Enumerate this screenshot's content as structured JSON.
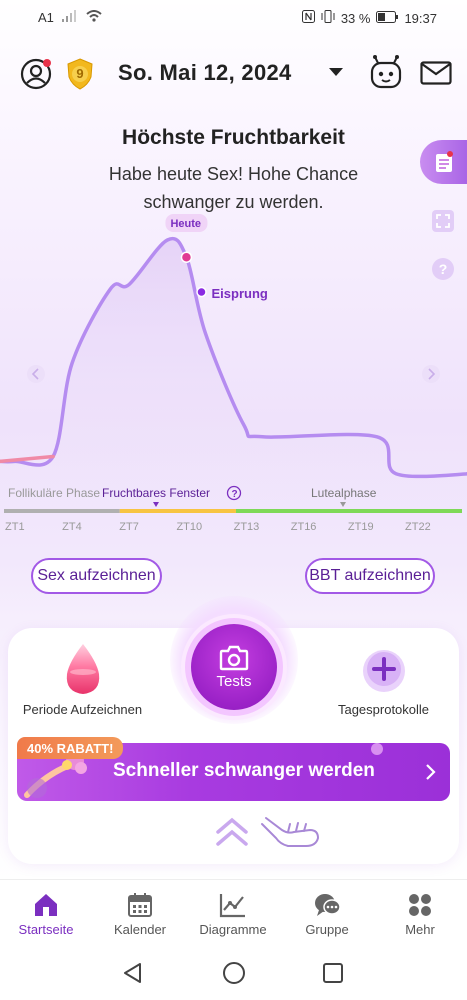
{
  "status_bar": {
    "carrier": "A1",
    "battery_text": "33 %",
    "time": "19:37"
  },
  "header": {
    "date": "So. Mai 12, 2024",
    "level_badge": "9"
  },
  "fertility": {
    "title": "Höchste Fruchtbarkeit",
    "subtitle": "Habe heute Sex! Hohe Chance schwanger zu werden."
  },
  "chart_data": {
    "type": "line",
    "markers": {
      "today": "Heute",
      "ovulation": "Eisprung"
    },
    "phases": [
      "Follikuläre Phase",
      "Fruchtbares Fenster",
      "Lutealphase"
    ],
    "x_ticks": [
      "ZT1",
      "ZT4",
      "ZT7",
      "ZT10",
      "ZT13",
      "ZT16",
      "ZT19",
      "ZT22"
    ],
    "x": [
      1,
      3,
      4,
      6,
      7,
      9,
      10,
      11,
      13,
      14,
      20,
      21,
      25
    ],
    "values": [
      0.1,
      0.12,
      0.5,
      0.8,
      0.82,
      1.0,
      0.93,
      0.62,
      0.25,
      0.2,
      0.2,
      0.05,
      0.05
    ],
    "today_x": 10,
    "ovulation_x": 11,
    "phase_colors": [
      "#b0b0b0",
      "#f7c442",
      "#7ed957"
    ]
  },
  "buttons": {
    "sex_record": "Sex aufzeichnen",
    "bbt_record": "BBT aufzeichnen"
  },
  "actions": {
    "period": "Periode Aufzeichnen",
    "tests": "Tests",
    "daily_logs": "Tagesprotokolle"
  },
  "promo": {
    "discount": "40% RABATT!",
    "text": "Schneller schwanger werden"
  },
  "tabs": [
    {
      "label": "Startseite",
      "icon": "home-icon",
      "active": true
    },
    {
      "label": "Kalender",
      "icon": "calendar-icon",
      "active": false
    },
    {
      "label": "Diagramme",
      "icon": "chart-icon",
      "active": false
    },
    {
      "label": "Gruppe",
      "icon": "chat-bubbles-icon",
      "active": false
    },
    {
      "label": "Mehr",
      "icon": "grid-icon",
      "active": false
    }
  ],
  "colors": {
    "accent": "#7b2fc0",
    "curve": "#b58cf0",
    "today_dot": "#e13b93",
    "ovulation_dot": "#8a2be2"
  }
}
